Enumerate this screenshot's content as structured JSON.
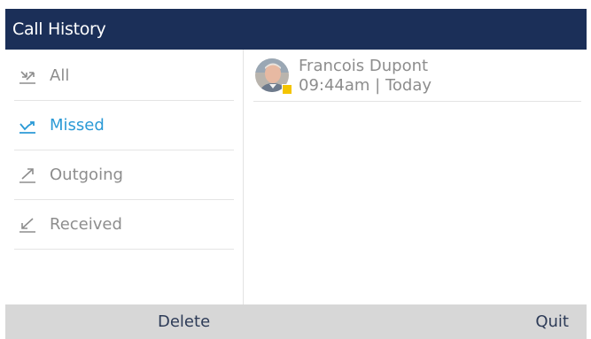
{
  "header": {
    "title": "Call History"
  },
  "filters": {
    "items": [
      {
        "label": "All",
        "icon": "all-calls-icon"
      },
      {
        "label": "Missed",
        "icon": "missed-calls-icon",
        "active": true
      },
      {
        "label": "Outgoing",
        "icon": "outgoing-call-icon"
      },
      {
        "label": "Received",
        "icon": "received-call-icon"
      }
    ]
  },
  "calls": [
    {
      "name": "Francois Dupont",
      "time": "09:44am | Today",
      "status_color": "#f4c400"
    }
  ],
  "softkeys": {
    "left": "Delete",
    "right": "Quit"
  },
  "colors": {
    "header_bg": "#1b2f58",
    "accent": "#2b9ad6",
    "inactive_text": "#8d8d8d",
    "softkey_bg": "#d7d7d7"
  }
}
